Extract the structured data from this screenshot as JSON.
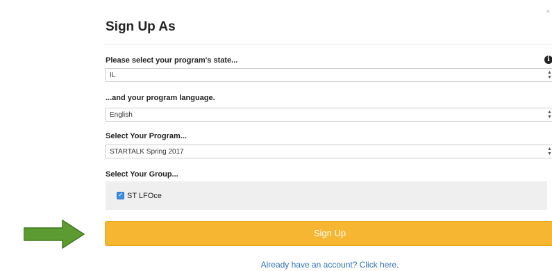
{
  "modal": {
    "title": "Sign Up As",
    "close_glyph": "×"
  },
  "state": {
    "label": "Please select your program's state...",
    "value": "IL",
    "info_icon": "info-icon"
  },
  "language": {
    "label": "...and your program language.",
    "value": "English"
  },
  "program": {
    "label": "Select Your Program...",
    "value": "STARTALK Spring 2017"
  },
  "group": {
    "label": "Select Your Group...",
    "items": [
      {
        "label": "ST LFOce",
        "checked": true
      }
    ]
  },
  "signup_button": {
    "label": "Sign Up",
    "color": "#f6b631"
  },
  "login_link": {
    "label": "Already have an account? Click here.",
    "color": "#2f6fb5"
  },
  "annotation": {
    "arrow_icon": "right-arrow-icon",
    "arrow_color": "#5b9b31"
  }
}
